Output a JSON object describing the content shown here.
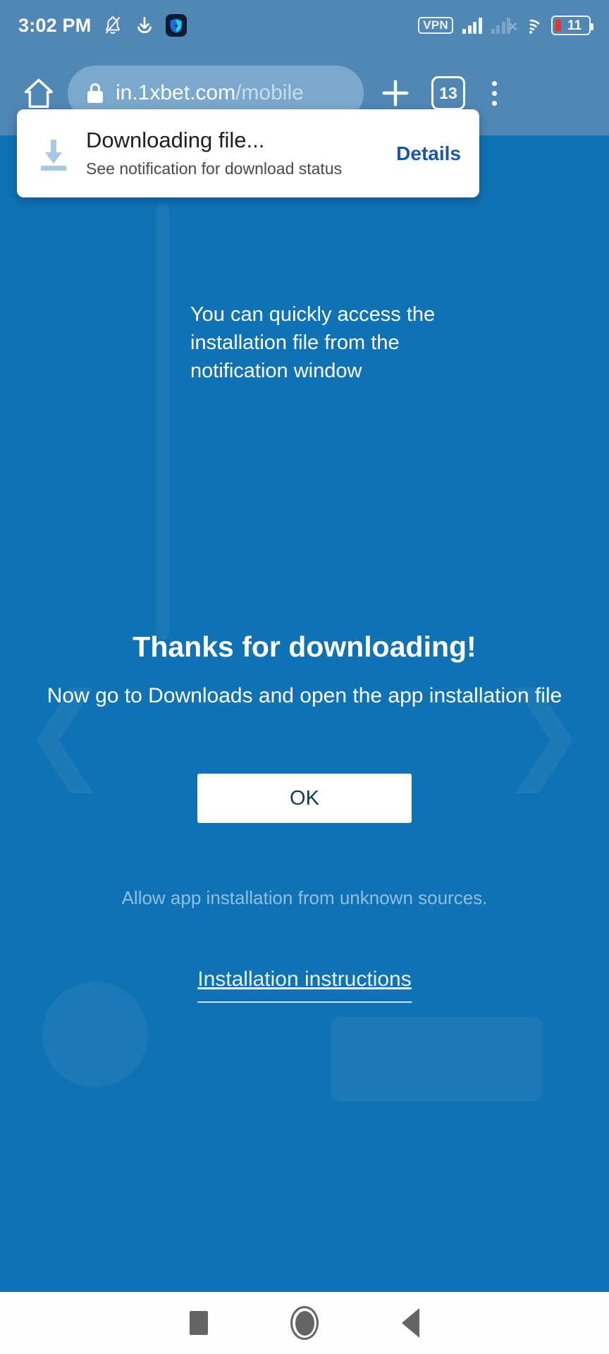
{
  "status_bar": {
    "time": "3:02 PM",
    "icons": [
      "notifications-silenced-icon",
      "download-icon",
      "vpn-shield-app-icon"
    ],
    "vpn_label": "VPN",
    "signal_primary": "4 bars",
    "signal_secondary": "no-sim",
    "wifi": "connected",
    "battery_percent": "11"
  },
  "browser": {
    "home_icon": "home-icon",
    "lock_icon": "lock-icon",
    "url_host": "in.1xbet.com",
    "url_path": "/mobile",
    "new_tab_icon": "plus-icon",
    "tab_count": "13",
    "menu_icon": "overflow-menu-icon"
  },
  "snackbar": {
    "icon": "download-arrow-icon",
    "title": "Downloading file...",
    "subtitle": "See notification for download status",
    "action_label": "Details",
    "action_color": "#1a56b0"
  },
  "page": {
    "notice": "You can quickly access the installation file from the notification window",
    "heading": "Thanks for downloading!",
    "subheading": "Now go to Downloads and open the app installation file",
    "ok_label": "OK",
    "unknown_sources": "Allow app installation from unknown sources.",
    "install_link": "Installation instructions",
    "background_color": "#0f72b5"
  },
  "nav_bar": {
    "recents": "recents-square-icon",
    "home": "home-circle-icon",
    "back": "back-triangle-icon"
  }
}
